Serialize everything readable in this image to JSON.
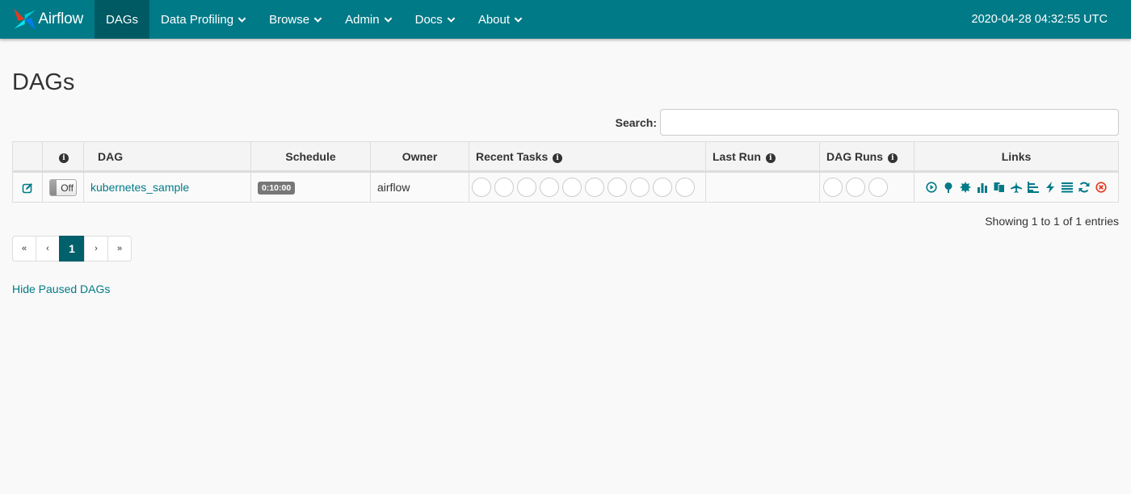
{
  "nav": {
    "brand": "Airflow",
    "items": [
      {
        "label": "DAGs",
        "active": true,
        "dropdown": false
      },
      {
        "label": "Data Profiling",
        "dropdown": true
      },
      {
        "label": "Browse",
        "dropdown": true
      },
      {
        "label": "Admin",
        "dropdown": true
      },
      {
        "label": "Docs",
        "dropdown": true
      },
      {
        "label": "About",
        "dropdown": true
      }
    ],
    "time": "2020-04-28 04:32:55 UTC"
  },
  "page": {
    "title": "DAGs",
    "search_label": "Search:",
    "search_value": ""
  },
  "table": {
    "columns": [
      "",
      "",
      "DAG",
      "Schedule",
      "Owner",
      "Recent Tasks",
      "Last Run",
      "DAG Runs",
      "Links"
    ],
    "rows": [
      {
        "toggle": "Off",
        "dag": "kubernetes_sample",
        "schedule": "0:10:00",
        "owner": "airflow",
        "last_run": "",
        "recent_tasks_count": 10,
        "dag_runs_count": 3
      }
    ]
  },
  "footer": {
    "showing": "Showing 1 to 1 of 1 entries",
    "pagination": [
      "«",
      "‹",
      "1",
      "›",
      "»"
    ],
    "active_page": "1",
    "hide_paused": "Hide Paused DAGs"
  },
  "colors": {
    "navbar": "#007a87",
    "nav_active": "#005a63",
    "link": "#007a87",
    "delete": "#e43921"
  },
  "icons": [
    "trigger-dag-icon",
    "tree-view-icon",
    "graph-view-icon",
    "duration-icon",
    "task-tries-icon",
    "landing-times-icon",
    "gantt-icon",
    "code-icon",
    "logs-icon",
    "refresh-icon",
    "delete-icon"
  ]
}
